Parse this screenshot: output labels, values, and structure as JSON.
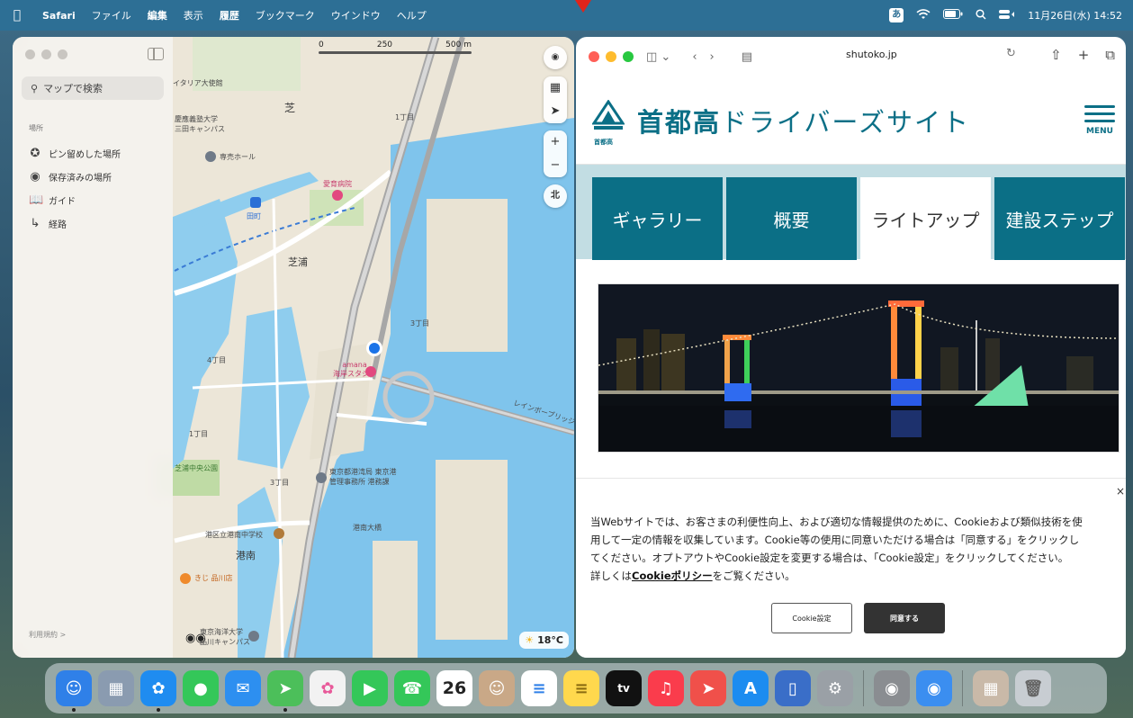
{
  "menubar": {
    "apple_icon": "apple-icon",
    "app_name": "Safari",
    "items": [
      "ファイル",
      "編集",
      "表示",
      "履歴",
      "ブックマーク",
      "ウインドウ",
      "ヘルプ"
    ],
    "ime_indicator": "あ",
    "datetime": "11月26日(水) 14:52"
  },
  "maps": {
    "search_placeholder": "マップで検索",
    "section_label": "場所",
    "sidebar_items": [
      {
        "label": "ピン留めした場所",
        "icon": "pin-icon"
      },
      {
        "label": "保存済みの場所",
        "icon": "saved-place-icon"
      },
      {
        "label": "ガイド",
        "icon": "guide-book-icon"
      },
      {
        "label": "経路",
        "icon": "route-icon"
      }
    ],
    "terms_link": "利用規約 >",
    "scale": {
      "labels": [
        "0",
        "250",
        "500 m"
      ]
    },
    "compass_label": "北",
    "weather": "18°C",
    "map_labels": {
      "italy": "イタリア大使館",
      "keio": "慶應義塾大学\n三田キャンパス",
      "tokyo_tower_area": "芝",
      "chome1": "1丁目",
      "chome3a": "3丁目",
      "chome4": "4丁目",
      "chome3b": "3丁目",
      "hospital": "愛育病院",
      "hall": "専売ホール",
      "tamachi": "田町",
      "shibaura": "芝浦",
      "amana": "amana\n海岸スタジオ",
      "park": "芝浦中央公園",
      "port_office": "東京都港湾局 東京港\n管理事務所 港務課",
      "school": "港区立港南中学校",
      "konan": "港南",
      "kiji": "きじ 品川店",
      "kaiyou": "東京海洋大学\n品川キャンパス",
      "chome1b": "1丁目",
      "rainbow": "レインボーブリッジ",
      "konan_bridge": "港南大橋"
    }
  },
  "safari": {
    "url": "shutoko.jp",
    "site_logo_small": "首都高",
    "site_title_prefix": "首都高",
    "site_title_suffix": "ドライバーズサイト",
    "menu_label": "MENU",
    "tabs": [
      "ギャラリー",
      "概要",
      "ライトアップ",
      "建設ステップ"
    ],
    "active_tab": "ライトアップ",
    "cookie": {
      "text_line1": "当Webサイトでは、お客さまの利便性向上、および適切な情報提供のために、Cookieおよび類似技術を使",
      "text_line2": "用して一定の情報を収集しています。Cookie等の使用に同意いただける場合は「同意する」をクリックし",
      "text_line3": "てください。オプトアウトやCookie設定を変更する場合は、「Cookie設定」をクリックしてください。",
      "text_line4_prefix": "詳しくは",
      "policy_link": "Cookieポリシー",
      "text_line4_suffix": "をご覧ください。",
      "settings_button": "Cookie設定",
      "agree_button": "同意する",
      "close": "×"
    }
  },
  "dock": {
    "calendar_day": "26",
    "apps": [
      {
        "name": "finder-icon",
        "color": "#2f80e8"
      },
      {
        "name": "launchpad-icon",
        "color": "#8a9bb0"
      },
      {
        "name": "safari-icon",
        "color": "#1f8cf0"
      },
      {
        "name": "messages-icon",
        "color": "#34c759"
      },
      {
        "name": "mail-icon",
        "color": "#2d8ff0"
      },
      {
        "name": "maps-icon",
        "color": "#4cbf5a"
      },
      {
        "name": "photos-icon",
        "color": "#f2f2f2"
      },
      {
        "name": "facetime-icon",
        "color": "#34c759"
      },
      {
        "name": "phone-icon",
        "color": "#34c759"
      },
      {
        "name": "calendar-icon",
        "color": "#ffffff"
      },
      {
        "name": "contacts-icon",
        "color": "#c9a887"
      },
      {
        "name": "reminders-icon",
        "color": "#ffffff"
      },
      {
        "name": "notes-icon",
        "color": "#ffd84d"
      },
      {
        "name": "tv-icon",
        "color": "#111111"
      },
      {
        "name": "music-icon",
        "color": "#fa3c4c"
      },
      {
        "name": "rocket-icon",
        "color": "#f0504a"
      },
      {
        "name": "app-store-icon",
        "color": "#1c8cf0"
      },
      {
        "name": "simulator-icon",
        "color": "#3a6ec8"
      },
      {
        "name": "settings-icon",
        "color": "#9aa0a6"
      },
      {
        "name": "screenshot-icon",
        "color": "#8a8d91"
      },
      {
        "name": "disk-utility-icon",
        "color": "#3b8ef0"
      },
      {
        "name": "map-thumbnail-icon",
        "color": "#c9b9a8"
      },
      {
        "name": "trash-icon",
        "color": "#c8cdd2"
      }
    ],
    "tv_label": "tv"
  }
}
